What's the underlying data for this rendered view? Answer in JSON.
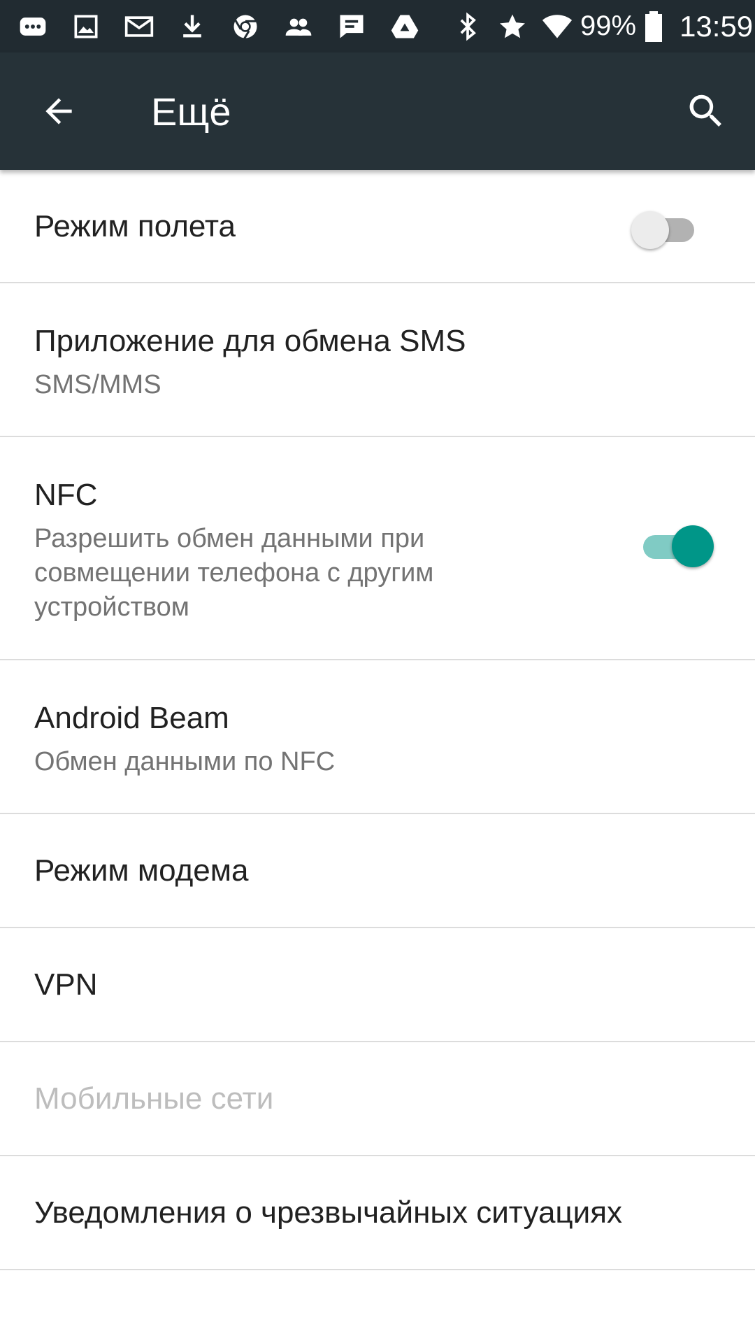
{
  "status_bar": {
    "left_icons": [
      "message-icon",
      "image-icon",
      "mail-icon",
      "download-icon",
      "chrome-icon",
      "contacts-icon",
      "chat-icon",
      "drive-icon"
    ],
    "right_icons": [
      "bluetooth-icon",
      "star-icon",
      "wifi-icon"
    ],
    "battery_text": "99%",
    "battery_level": 0.99,
    "time": "13:59"
  },
  "toolbar": {
    "title": "Ещё",
    "back_icon": "arrow-back-icon",
    "search_icon": "search-icon"
  },
  "items": [
    {
      "title": "Режим полета",
      "summary": "",
      "switch": false,
      "enabled": true
    },
    {
      "title": "Приложение для обмена SMS",
      "summary": "SMS/MMS",
      "enabled": true
    },
    {
      "title": "NFC",
      "summary_lines": [
        "Разрешить обмен данными при",
        "совмещении телефона с другим",
        "устройством"
      ],
      "switch": true,
      "enabled": true
    },
    {
      "title": "Android Beam",
      "summary": "Обмен данными по NFC",
      "enabled": true
    },
    {
      "title": "Режим модема",
      "enabled": true
    },
    {
      "title": "VPN",
      "enabled": true
    },
    {
      "title": "Мобильные сети",
      "enabled": false
    },
    {
      "title": "Уведомления о чрезвычайных ситуациях",
      "enabled": true
    }
  ],
  "colors": {
    "status_bar": "#212b31",
    "toolbar": "#263238",
    "accent": "#009688",
    "accent_track": "#80cbc4",
    "off_thumb": "#ececec",
    "off_track": "#b2b2b2"
  }
}
